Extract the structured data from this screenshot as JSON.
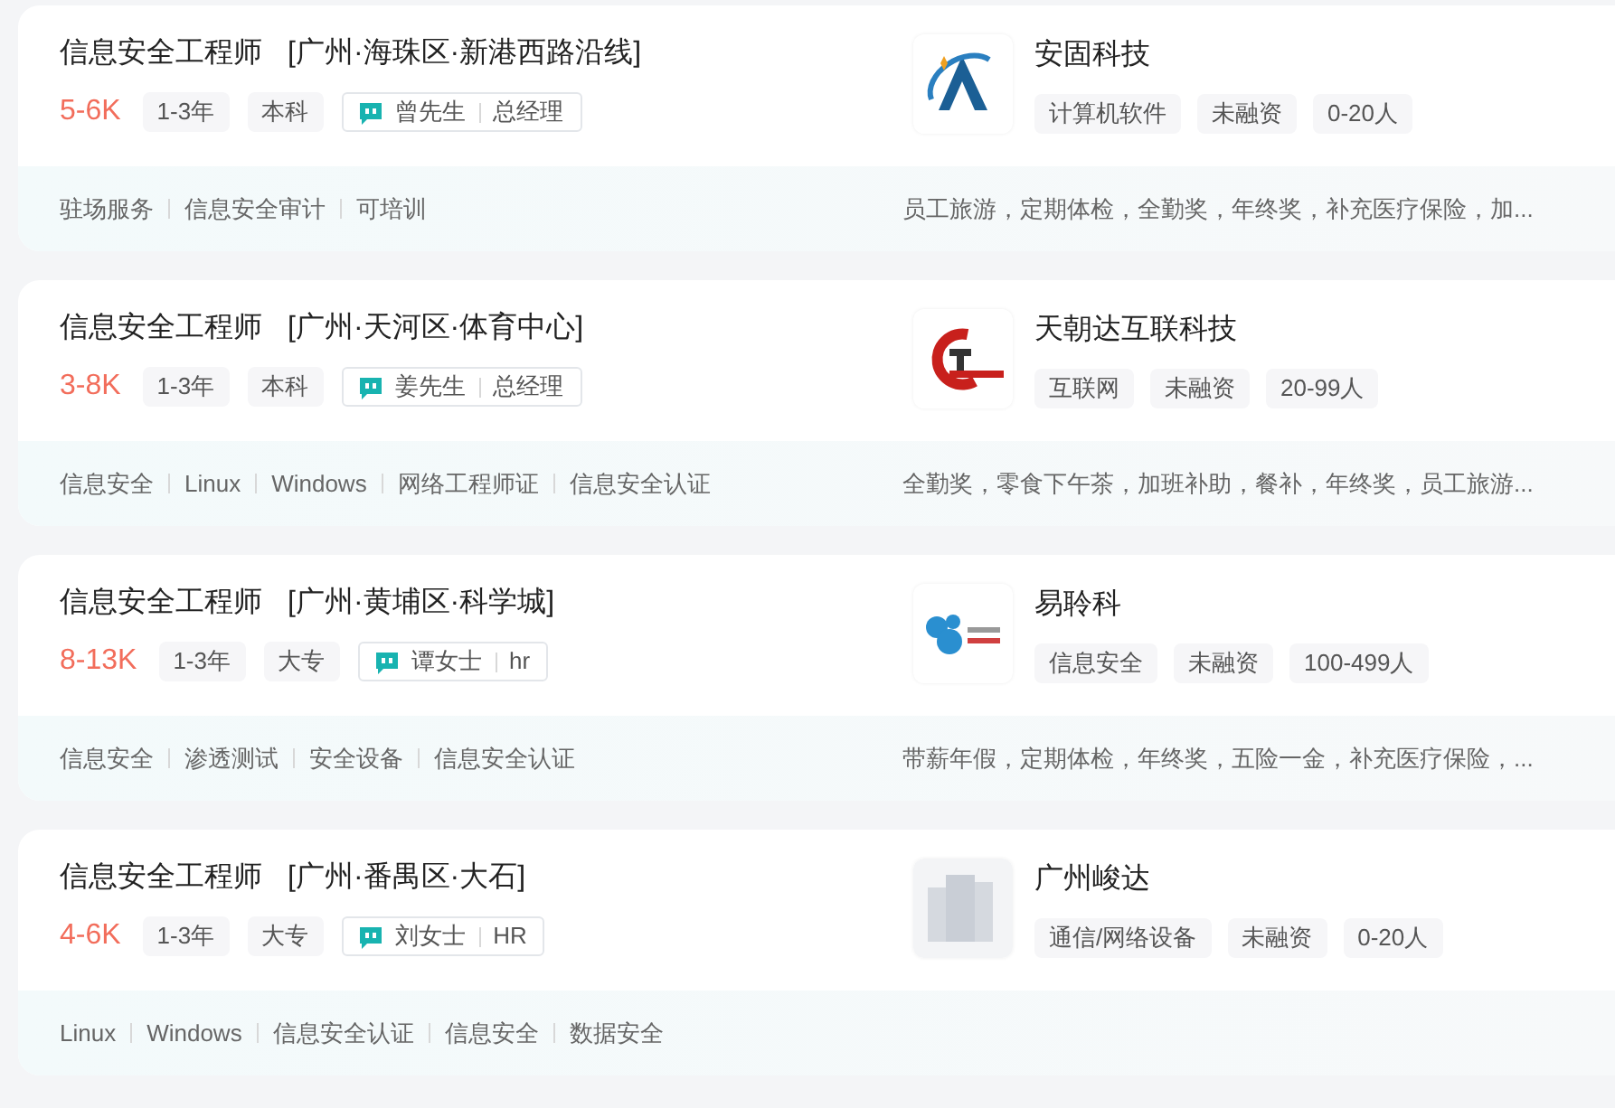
{
  "jobs": [
    {
      "title": "信息安全工程师",
      "location": "[广州·海珠区·新港西路沿线]",
      "salary": "5-6K",
      "requirements": [
        "1-3年",
        "本科"
      ],
      "recruiter": {
        "name": "曾先生",
        "role": "总经理"
      },
      "company": {
        "name": "安固科技",
        "logo": {
          "kind": "letter-a"
        },
        "tags": [
          "计算机软件",
          "未融资",
          "0-20人"
        ]
      },
      "skills": [
        "驻场服务",
        "信息安全审计",
        "可培训"
      ],
      "benefits": "员工旅游，定期体检，全勤奖，年终奖，补充医疗保险，加..."
    },
    {
      "title": "信息安全工程师",
      "location": "[广州·天河区·体育中心]",
      "salary": "3-8K",
      "requirements": [
        "1-3年",
        "本科"
      ],
      "recruiter": {
        "name": "姜先生",
        "role": "总经理"
      },
      "company": {
        "name": "天朝达互联科技",
        "logo": {
          "kind": "ring"
        },
        "tags": [
          "互联网",
          "未融资",
          "20-99人"
        ]
      },
      "skills": [
        "信息安全",
        "Linux",
        "Windows",
        "网络工程师证",
        "信息安全认证"
      ],
      "benefits": "全勤奖，零食下午茶，加班补助，餐补，年终奖，员工旅游..."
    },
    {
      "title": "信息安全工程师",
      "location": "[广州·黄埔区·科学城]",
      "salary": "8-13K",
      "requirements": [
        "1-3年",
        "大专"
      ],
      "recruiter": {
        "name": "谭女士",
        "role": "hr"
      },
      "company": {
        "name": "易聆科",
        "logo": {
          "kind": "dots"
        },
        "tags": [
          "信息安全",
          "未融资",
          "100-499人"
        ]
      },
      "skills": [
        "信息安全",
        "渗透测试",
        "安全设备",
        "信息安全认证"
      ],
      "benefits": "带薪年假，定期体检，年终奖，五险一金，补充医疗保险，..."
    },
    {
      "title": "信息安全工程师",
      "location": "[广州·番禺区·大石]",
      "salary": "4-6K",
      "requirements": [
        "1-3年",
        "大专"
      ],
      "recruiter": {
        "name": "刘女士",
        "role": "HR"
      },
      "company": {
        "name": "广州峻达",
        "logo": {
          "kind": "building"
        },
        "tags": [
          "通信/网络设备",
          "未融资",
          "0-20人"
        ]
      },
      "skills": [
        "Linux",
        "Windows",
        "信息安全认证",
        "信息安全",
        "数据安全"
      ]
    }
  ]
}
